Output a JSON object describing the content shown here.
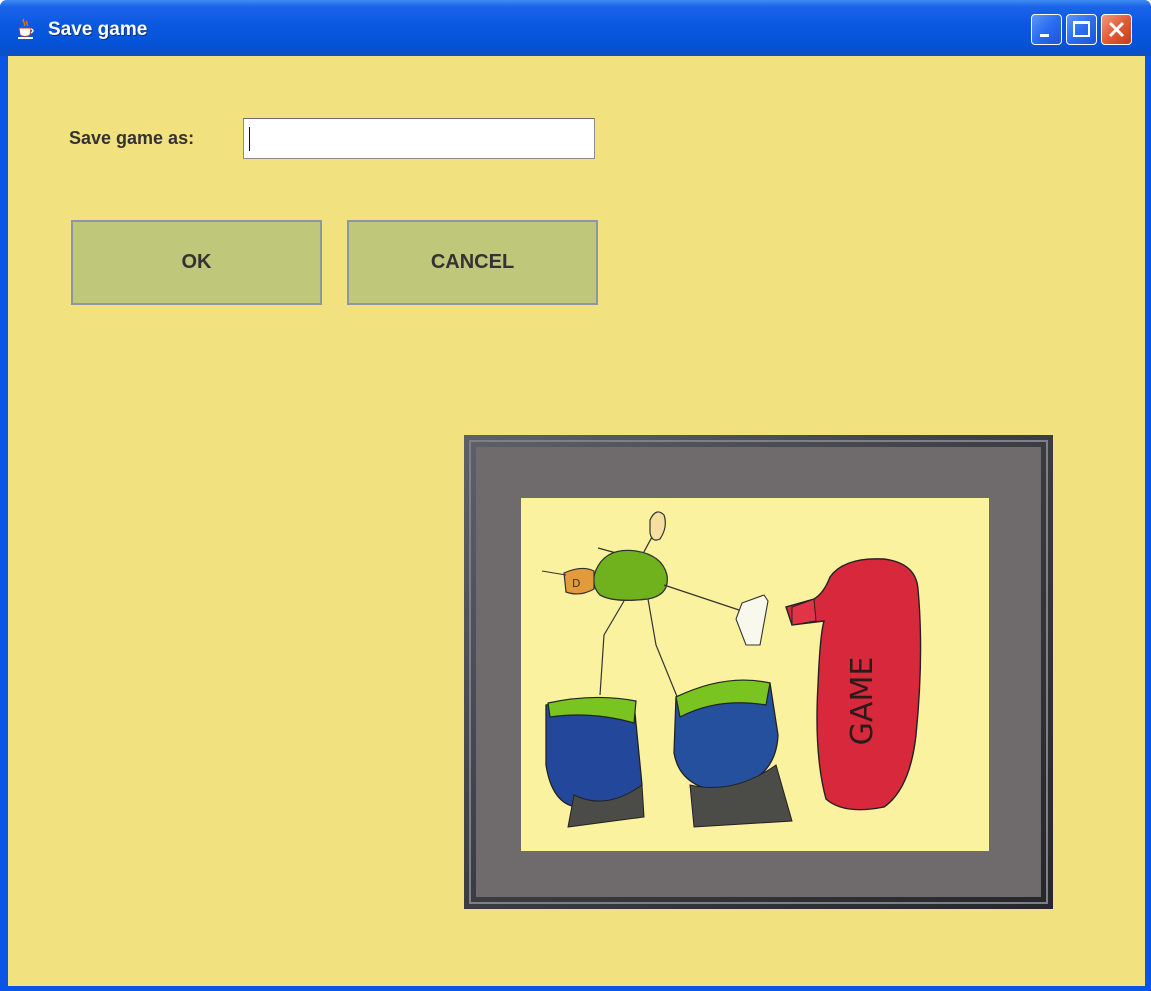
{
  "window": {
    "title": "Save game",
    "title_icon": "java-coffee-cup-icon",
    "controls": [
      {
        "name": "minimize-button",
        "icon": "minimize-icon"
      },
      {
        "name": "maximize-button",
        "icon": "maximize-icon"
      },
      {
        "name": "close-button",
        "icon": "close-icon"
      }
    ]
  },
  "form": {
    "label": "Save game as:",
    "input_value": "",
    "input_placeholder": ""
  },
  "buttons": {
    "ok": "OK",
    "cancel": "CANCEL"
  },
  "artwork": {
    "painted_text": "GAME"
  },
  "colors": {
    "background": "#f2e17f",
    "button": "#bfc77a",
    "titlebar": "#0a58e0"
  }
}
